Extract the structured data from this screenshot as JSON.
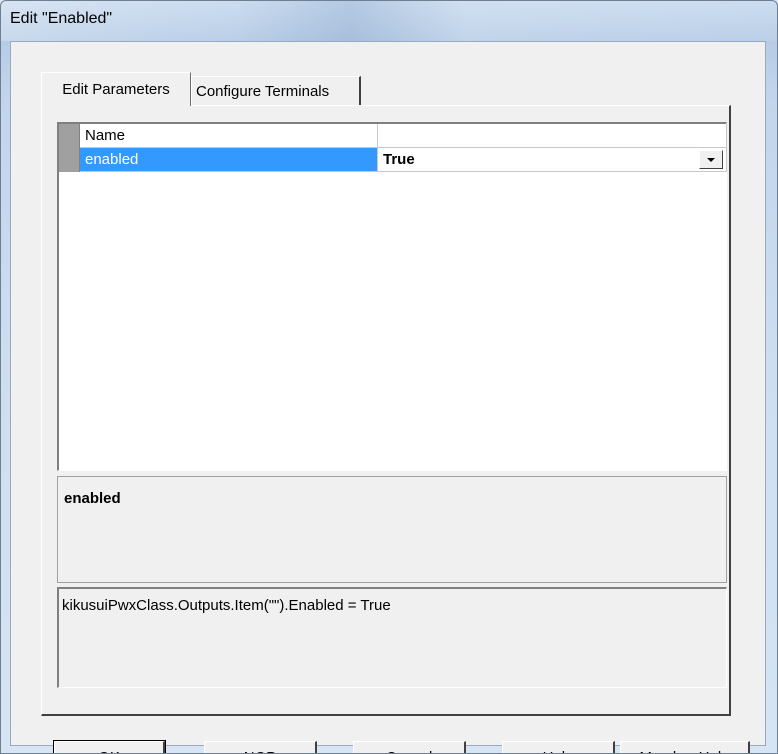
{
  "window": {
    "title": "Edit \"Enabled\""
  },
  "tabs": [
    {
      "label": "Edit Parameters",
      "active": true
    },
    {
      "label": "Configure Terminals",
      "active": false
    }
  ],
  "grid": {
    "header": {
      "name": "Name",
      "value": ""
    },
    "rows": [
      {
        "name": "enabled",
        "value": "True",
        "selected": true
      }
    ]
  },
  "description": {
    "title": "enabled"
  },
  "code": {
    "text": "kikusuiPwxClass.Outputs.Item(\"\").Enabled = True"
  },
  "buttons": {
    "ok": "OK",
    "nop": "NOP",
    "cancel": "Cancel",
    "help": "Help",
    "member_help": "Member Help"
  },
  "colors": {
    "selection": "#3399ff",
    "face": "#f0f0f0"
  }
}
